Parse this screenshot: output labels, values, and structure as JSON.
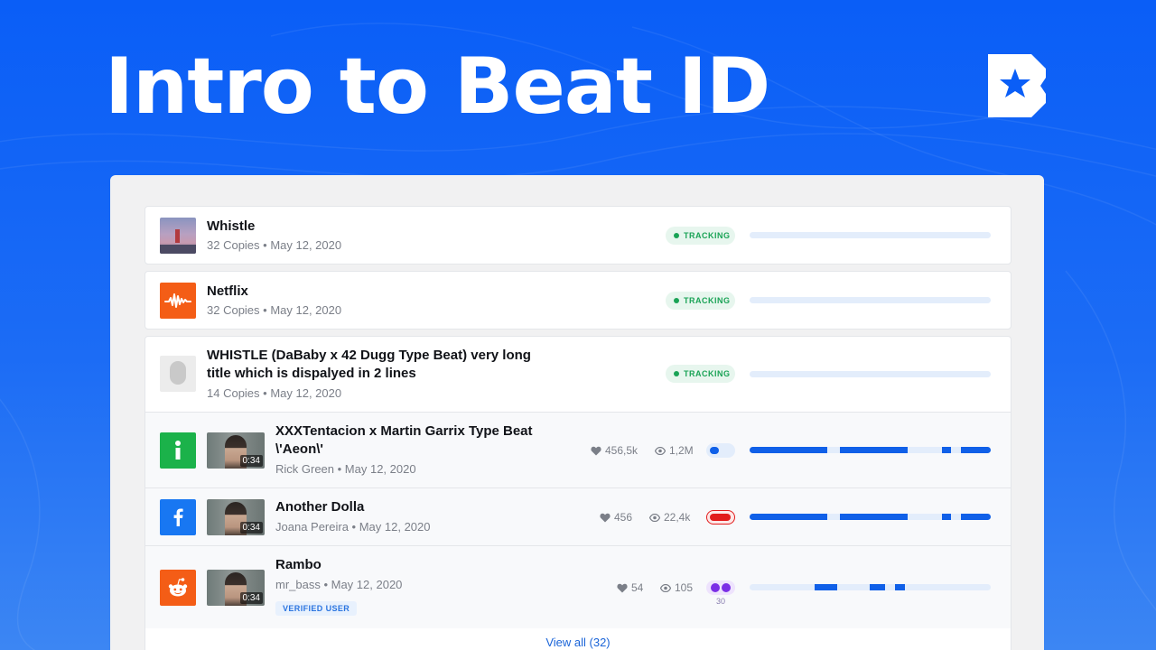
{
  "hero": {
    "title": "Intro to Beat ID"
  },
  "colors": {
    "background": "#0a5ef7",
    "accent": "#1060e8",
    "tracking": "#1aa356",
    "danger": "#e21b1b",
    "purple": "#7b2ee6"
  },
  "tracked_beats": [
    {
      "title": "Whistle",
      "meta": "32 Copies • May 12, 2020",
      "status": "TRACKING",
      "thumbnail": "sunset-lighthouse-thumbnail"
    },
    {
      "title": "Netflix",
      "meta": "32 Copies • May 12, 2020",
      "status": "TRACKING",
      "thumbnail": "audiomack-waveform-logo"
    },
    {
      "title": "WHISTLE (DaBaby x 42 Dugg Type Beat) very long title which is dispalyed in 2 lines",
      "meta": "14 Copies • May 12, 2020",
      "status": "TRACKING",
      "thumbnail": "person-thumbnail"
    }
  ],
  "copies": [
    {
      "platform": "info-icon",
      "title": "XXXTentacion x Martin Garrix Type Beat \\'Aeon\\'",
      "meta": "Rick Green • May 12, 2020",
      "duration": "0:34",
      "likes": "456,5k",
      "views": "1,2M",
      "indicator": "blue-toggle"
    },
    {
      "platform": "facebook-icon",
      "title": "Another Dolla",
      "meta": "Joana Pereira • May 12, 2020",
      "duration": "0:34",
      "likes": "456",
      "views": "22,4k",
      "indicator": "red-pill"
    },
    {
      "platform": "reddit-icon",
      "title": "Rambo",
      "meta": "mr_bass • May 12, 2020",
      "duration": "0:34",
      "likes": "54",
      "views": "105",
      "indicator": "purple-dots",
      "indicator_count": "30",
      "verified": "VERIFIED USER"
    }
  ],
  "footer": {
    "view_all": "View all (32)"
  }
}
